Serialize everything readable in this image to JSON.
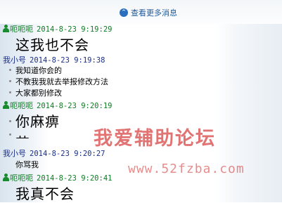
{
  "header": {
    "more_link": "查看更多消息",
    "more_icon": "up-arrow-icon"
  },
  "messages": [
    {
      "sender": "呃呃呃",
      "time": "2014-8-23 9:19:29",
      "color": "#0d7d23",
      "text": "这我也不会"
    },
    {
      "sender": "我小号",
      "time": "2014-8-23 9:19:38",
      "color": "#1a2f8a",
      "lines": [
        "我知道你会的",
        "不教我我就去举报修改方法",
        "大家都别修改"
      ]
    },
    {
      "sender": "呃呃呃",
      "time": "2014-8-23 9:20:19",
      "color": "#0d7d23",
      "text": "你麻痹",
      "text_cut": "艹"
    },
    {
      "sender": "我小号",
      "time": "2014-8-23 9:20:27",
      "color": "#1a2f8a",
      "text": "你骂我"
    },
    {
      "sender": "呃呃呃",
      "time": "2014-8-23 9:20:41",
      "color": "#0d7d23",
      "text": "我真不会"
    }
  ],
  "watermark": {
    "title": "我爱辅助论坛",
    "url": "www.52fzba.com",
    "color": "#c80000"
  }
}
